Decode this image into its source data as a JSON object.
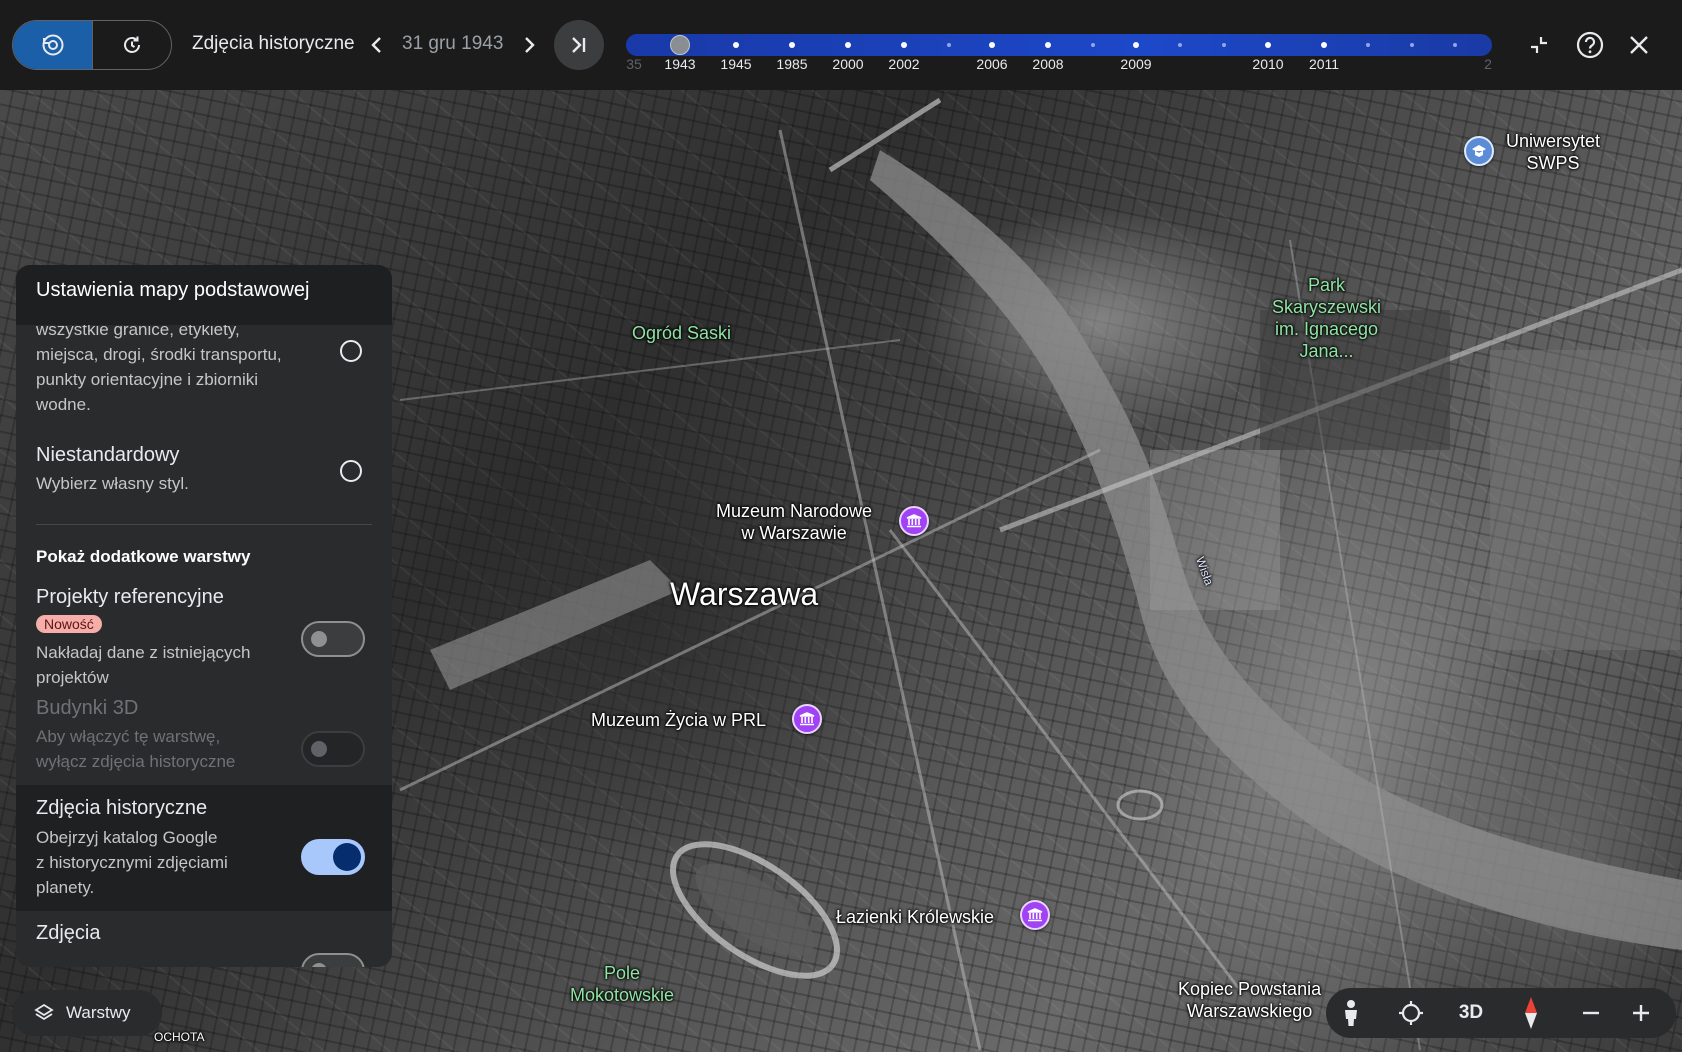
{
  "toolbar": {
    "title": "Zdjęcia historyczne",
    "date": "31 gru 1943",
    "prev_icon": "chevron-left-icon",
    "next_icon": "chevron-right-icon",
    "skip_icon": "skip-to-latest-icon"
  },
  "timeline": {
    "left_cut_label": "35",
    "right_cut_label": "2",
    "selected": "1943",
    "years": [
      "1943",
      "1945",
      "1985",
      "2000",
      "2002",
      "2006",
      "2008",
      "2009",
      "2010",
      "2011"
    ],
    "track_color": "#1d48c8"
  },
  "map": {
    "labels": {
      "ogrod_saski": "Ogród Saski",
      "uniwersytet_1": "Uniwersytet",
      "uniwersytet_2": "SWPS",
      "park_1": "Park",
      "park_2": "Skaryszewski",
      "park_3": "im. Ignacego",
      "park_4": "Jana...",
      "muzeum_narodowe_1": "Muzeum Narodowe",
      "muzeum_narodowe_2": "w Warszawie",
      "warszawa": "Warszawa",
      "wisla": "Wisła",
      "muzeum_prl": "Muzeum Życia w PRL",
      "lazienki": "Łazienki Królewskie",
      "pole_1": "Pole",
      "pole_2": "Mokotowskie",
      "kopiec_1": "Kopiec Powstania",
      "kopiec_2": "Warszawskiego",
      "ochota": "OCHOTA"
    }
  },
  "panel": {
    "title": "Ustawienia mapy podstawowej",
    "option_all": {
      "lines": [
        "wszystkie granice, etykiety,",
        "miejsca, drogi, środki transportu,",
        "punkty orientacyjne i zbiorniki",
        "wodne."
      ]
    },
    "option_custom": {
      "title": "Niestandardowy",
      "subtitle": "Wybierz własny styl."
    },
    "section_title": "Pokaż dodatkowe warstwy",
    "layers": [
      {
        "title": "Projekty referencyjne",
        "badge": "Nowość",
        "lines": [
          "Nakładaj dane z istniejących",
          "projektów"
        ],
        "enabled": false
      },
      {
        "title": "Budynki 3D",
        "lines": [
          "Aby włączyć tę warstwę,",
          "wyłącz zdjęcia historyczne"
        ],
        "enabled": false
      },
      {
        "title": "Zdjęcia historyczne",
        "lines": [
          "Obejrzyj katalog Google",
          "z historycznymi zdjęciami",
          "planety."
        ],
        "enabled": true
      },
      {
        "title": "Zdjęcia"
      }
    ]
  },
  "bottom": {
    "layers_label": "Warstwy",
    "view_3d_label": "3D"
  },
  "colors": {
    "accent": "#1a5fa8",
    "toggle_on": "#a8c7fa",
    "poi": "#a142f4",
    "badge": "#f6aea9"
  }
}
